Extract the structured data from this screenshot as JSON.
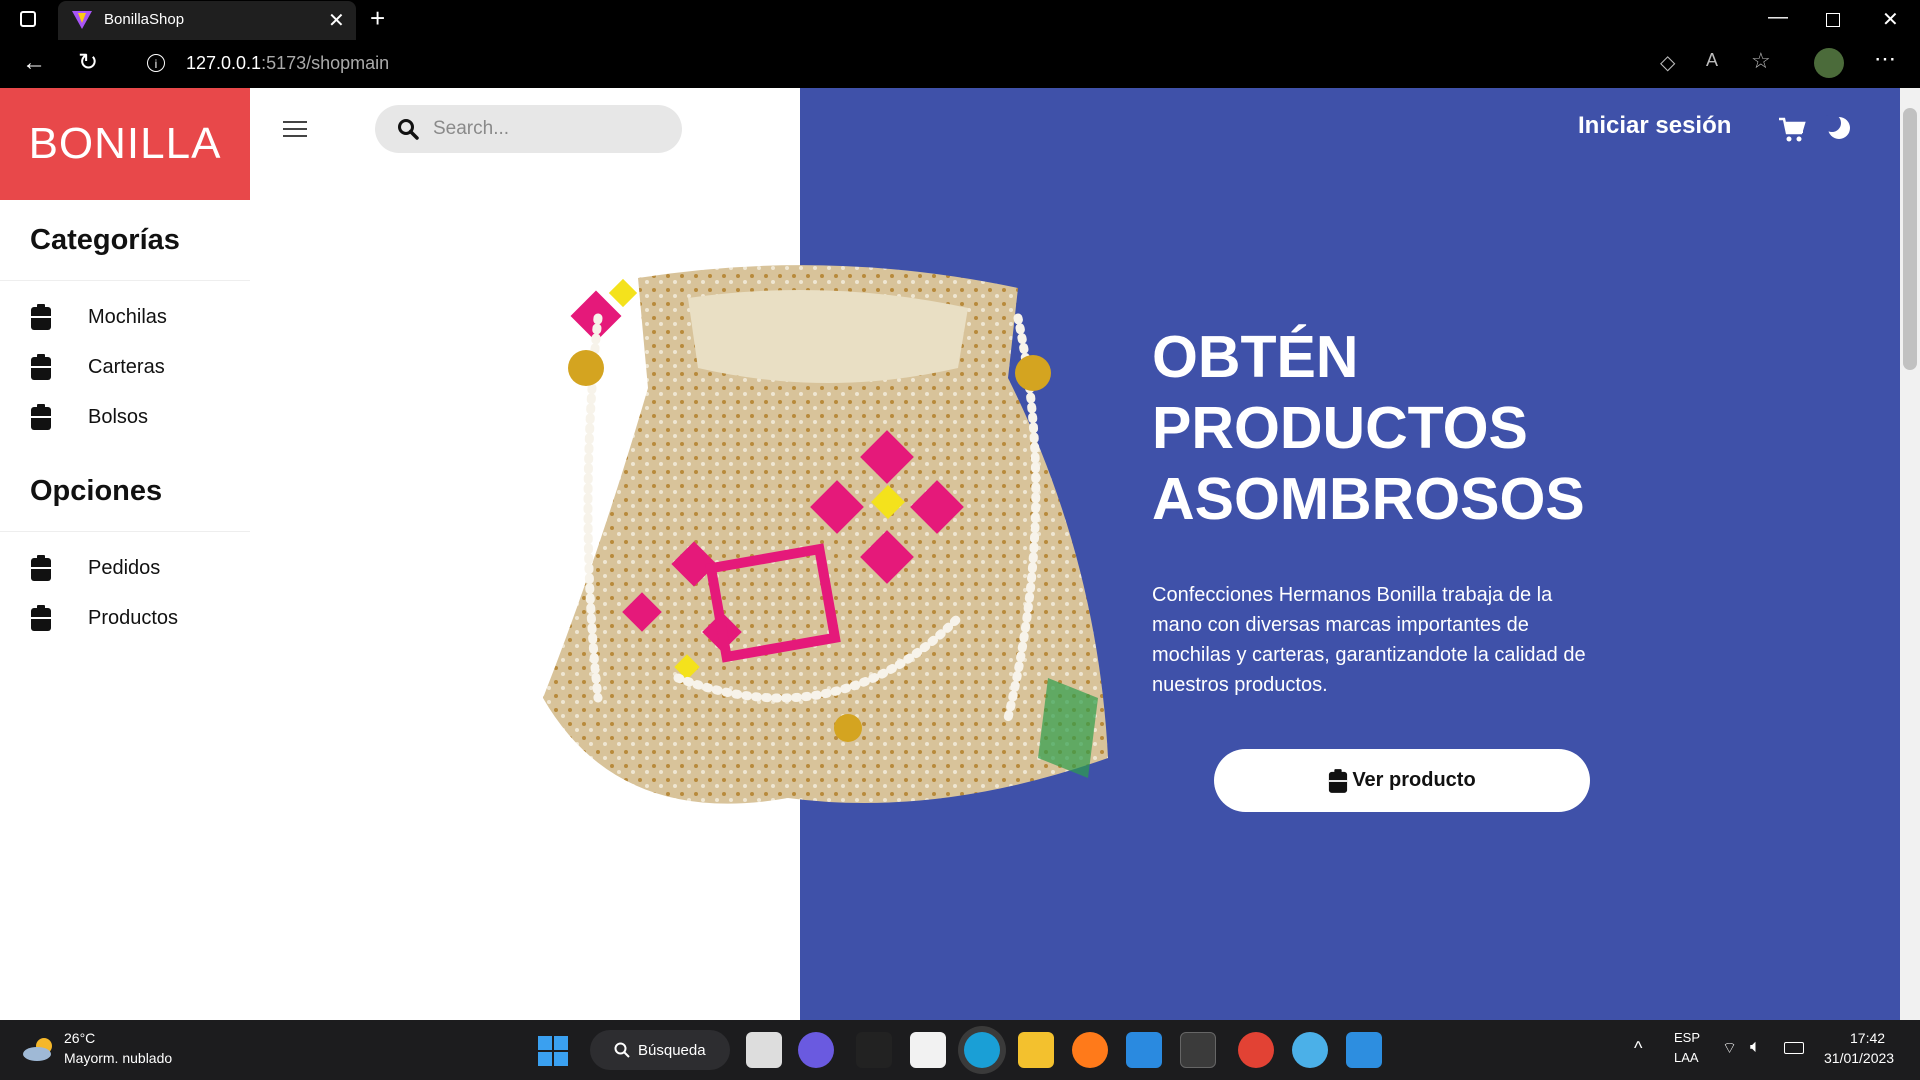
{
  "browser": {
    "tab_title": "BonillaShop",
    "url_host": "127.0.0.1",
    "url_path": ":5173/shopmain"
  },
  "header": {
    "brand": "BONILLA",
    "search_placeholder": "Search...",
    "login": "Iniciar sesión"
  },
  "sidebar": {
    "categories_title": "Categorías",
    "categories": [
      {
        "label": "Mochilas"
      },
      {
        "label": "Carteras"
      },
      {
        "label": "Bolsos"
      }
    ],
    "options_title": "Opciones",
    "options": [
      {
        "label": "Pedidos"
      },
      {
        "label": "Productos"
      }
    ]
  },
  "hero": {
    "title_line1": "OBTÉN",
    "title_line2": "PRODUCTOS",
    "title_line3": "ASOMBROSOS",
    "description": "Confecciones Hermanos Bonilla trabaja de la mano con diversas marcas importantes de mochilas y carteras, garantizandote la calidad de nuestros productos.",
    "cta": "Ver producto"
  },
  "taskbar": {
    "temperature": "26°C",
    "weather": "Mayorm. nublado",
    "search": "Búsqueda",
    "lang1": "ESP",
    "lang2": "LAA",
    "time": "17:42",
    "date": "31/01/2023"
  },
  "colors": {
    "brand": "#e8484a",
    "hero_bg": "#3f51a9"
  }
}
